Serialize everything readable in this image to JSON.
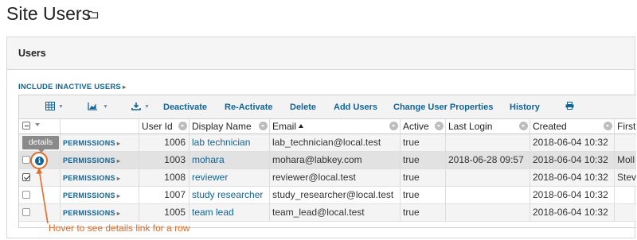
{
  "page": {
    "title": "Site Users",
    "folder_icon": "folder-icon"
  },
  "panel": {
    "title": "Users"
  },
  "include_inactive": "INCLUDE INACTIVE USERS",
  "toolbar": {
    "icons": [
      "grid-icon",
      "chart-icon",
      "export-icon",
      "print-icon"
    ],
    "buttons": [
      "Deactivate",
      "Re-Activate",
      "Delete",
      "Add Users",
      "Change User Properties",
      "History"
    ]
  },
  "columns": [
    "Display Name",
    "Email",
    "Active",
    "Last Login",
    "Created",
    "First"
  ],
  "columns_userid": "User Id",
  "permissions_label": "PERMISSIONS",
  "rows": [
    {
      "user_id": "1006",
      "display_name": "lab technician",
      "email": "lab_technician@local.test",
      "active": "true",
      "last_login": "",
      "created": "2018-06-04 10:32",
      "first": "",
      "checked": false
    },
    {
      "user_id": "1003",
      "display_name": "mohara",
      "email": "mohara@labkey.com",
      "active": "true",
      "last_login": "2018-06-28 09:57",
      "created": "2018-06-04 10:32",
      "first": "Moll",
      "checked": false
    },
    {
      "user_id": "1008",
      "display_name": "reviewer",
      "email": "reviewer@local.test",
      "active": "true",
      "last_login": "",
      "created": "2018-06-04 10:32",
      "first": "Stev",
      "checked": true
    },
    {
      "user_id": "1007",
      "display_name": "study researcher",
      "email": "study_researcher@local.test",
      "active": "true",
      "last_login": "",
      "created": "2018-06-04 10:32",
      "first": "",
      "checked": false
    },
    {
      "user_id": "1005",
      "display_name": "team lead",
      "email": "team_lead@local.test",
      "active": "true",
      "last_login": "",
      "created": "2018-06-04 10:32",
      "first": "",
      "checked": false
    }
  ],
  "tooltip": "details",
  "callout": "Hover to see details link for a row",
  "colors": {
    "link": "#126495",
    "accent": "#e26b2a",
    "tooltip_bg": "#8a8a8a"
  }
}
